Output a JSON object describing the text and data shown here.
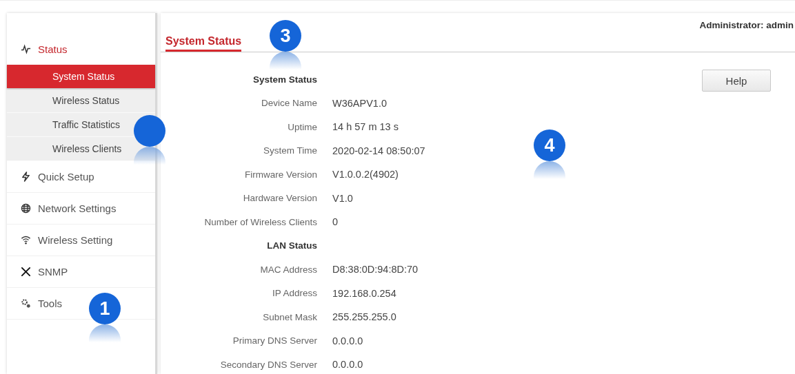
{
  "header": {
    "user": "Administrator: admin",
    "tab": {
      "label": "System Status",
      "selected": true
    }
  },
  "sidebar": {
    "items": [
      {
        "label": "Status",
        "kind": "pulse",
        "selected": true,
        "children": [
          {
            "label": "System Status",
            "selected": true
          },
          {
            "label": "Wireless Status",
            "selected": false
          },
          {
            "label": "Traffic Statistics",
            "selected": false
          },
          {
            "label": "Wireless Clients",
            "selected": false
          }
        ]
      },
      {
        "label": "Quick Setup",
        "kind": "bolt",
        "selected": false
      },
      {
        "label": "Network Settings",
        "kind": "globe",
        "selected": false
      },
      {
        "label": "Wireless Setting",
        "kind": "wifi",
        "selected": false
      },
      {
        "label": "SNMP",
        "kind": "tools",
        "selected": false
      },
      {
        "label": "Tools",
        "kind": "gears",
        "selected": false
      }
    ]
  },
  "help_button": "Help",
  "rows": [
    {
      "kind": "heading",
      "label": "System Status"
    },
    {
      "kind": "field",
      "label": "Device Name",
      "value": "W36APV1.0"
    },
    {
      "kind": "field",
      "label": "Uptime",
      "value": "14 h 57 m 13 s"
    },
    {
      "kind": "field",
      "label": "System Time",
      "value": "2020-02-14 08:50:07"
    },
    {
      "kind": "field",
      "label": "Firmware Version",
      "value": "V1.0.0.2(4902)"
    },
    {
      "kind": "field",
      "label": "Hardware Version",
      "value": "V1.0"
    },
    {
      "kind": "field",
      "label": "Number of Wireless Clients",
      "value": "0"
    },
    {
      "kind": "heading",
      "label": "LAN Status"
    },
    {
      "kind": "field",
      "label": "MAC Address",
      "value": "D8:38:0D:94:8D:70"
    },
    {
      "kind": "field",
      "label": "IP Address",
      "value": "192.168.0.254"
    },
    {
      "kind": "field",
      "label": "Subnet Mask",
      "value": "255.255.255.0"
    },
    {
      "kind": "field",
      "label": "Primary DNS Server",
      "value": "0.0.0.0"
    },
    {
      "kind": "field",
      "label": "Secondary DNS Server",
      "value": "0.0.0.0"
    }
  ],
  "callouts": [
    {
      "kind": "numbered",
      "label": "3"
    },
    {
      "kind": "blank"
    },
    {
      "kind": "numbered",
      "label": "4"
    },
    {
      "kind": "numbered",
      "label": "1"
    }
  ]
}
